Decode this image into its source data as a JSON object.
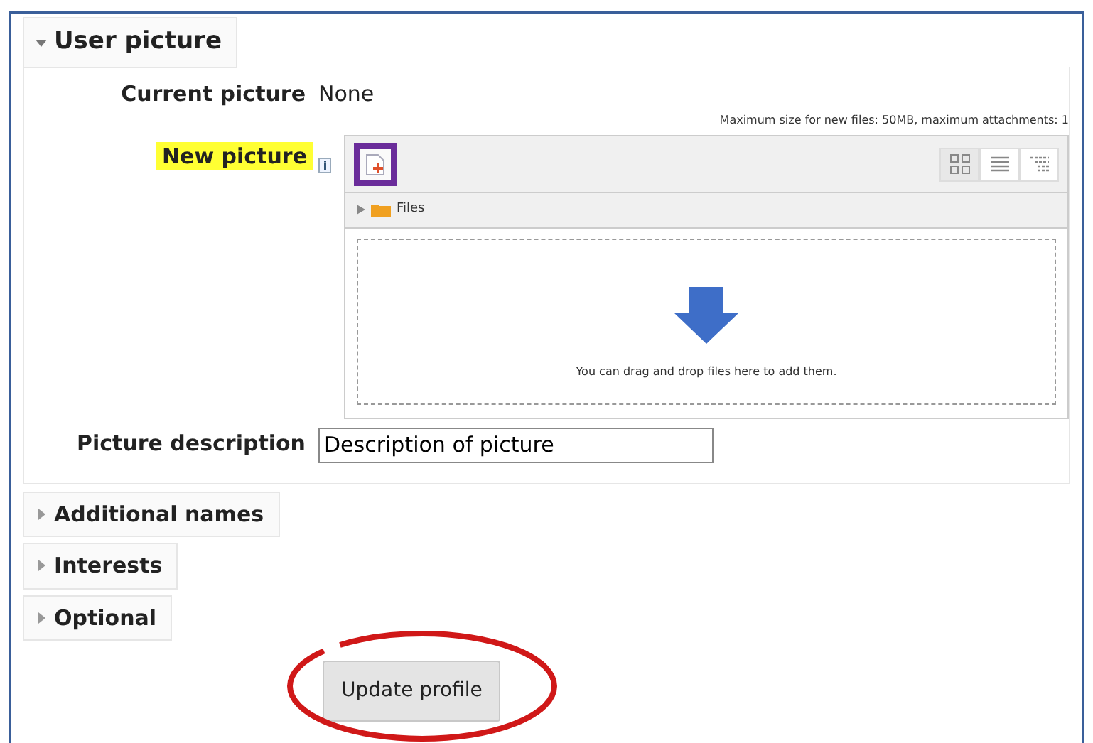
{
  "sections": [
    {
      "title": "User picture",
      "expanded": true,
      "fields": [
        {
          "kind": "static",
          "label": "Current picture",
          "value": "None",
          "highlighted": false
        },
        {
          "kind": "filepicker",
          "label": "New picture",
          "highlighted": true,
          "limits": "Maximum size for new files: 50MB, maximum attachments: 1",
          "add_button_highlighted": true,
          "views": [
            {
              "kind": "icons",
              "selected": true
            },
            {
              "kind": "list",
              "selected": false
            },
            {
              "kind": "tree",
              "selected": false
            }
          ],
          "folder": "Files",
          "drop_hint": "You can drag and drop files here to add them."
        },
        {
          "kind": "text",
          "label": "Picture description",
          "value": "Description of picture",
          "highlighted": false
        }
      ]
    },
    {
      "title": "Additional names",
      "expanded": false
    },
    {
      "title": "Interests",
      "expanded": false
    },
    {
      "title": "Optional",
      "expanded": false
    }
  ],
  "submit": {
    "label": "Update profile",
    "circled": true
  }
}
